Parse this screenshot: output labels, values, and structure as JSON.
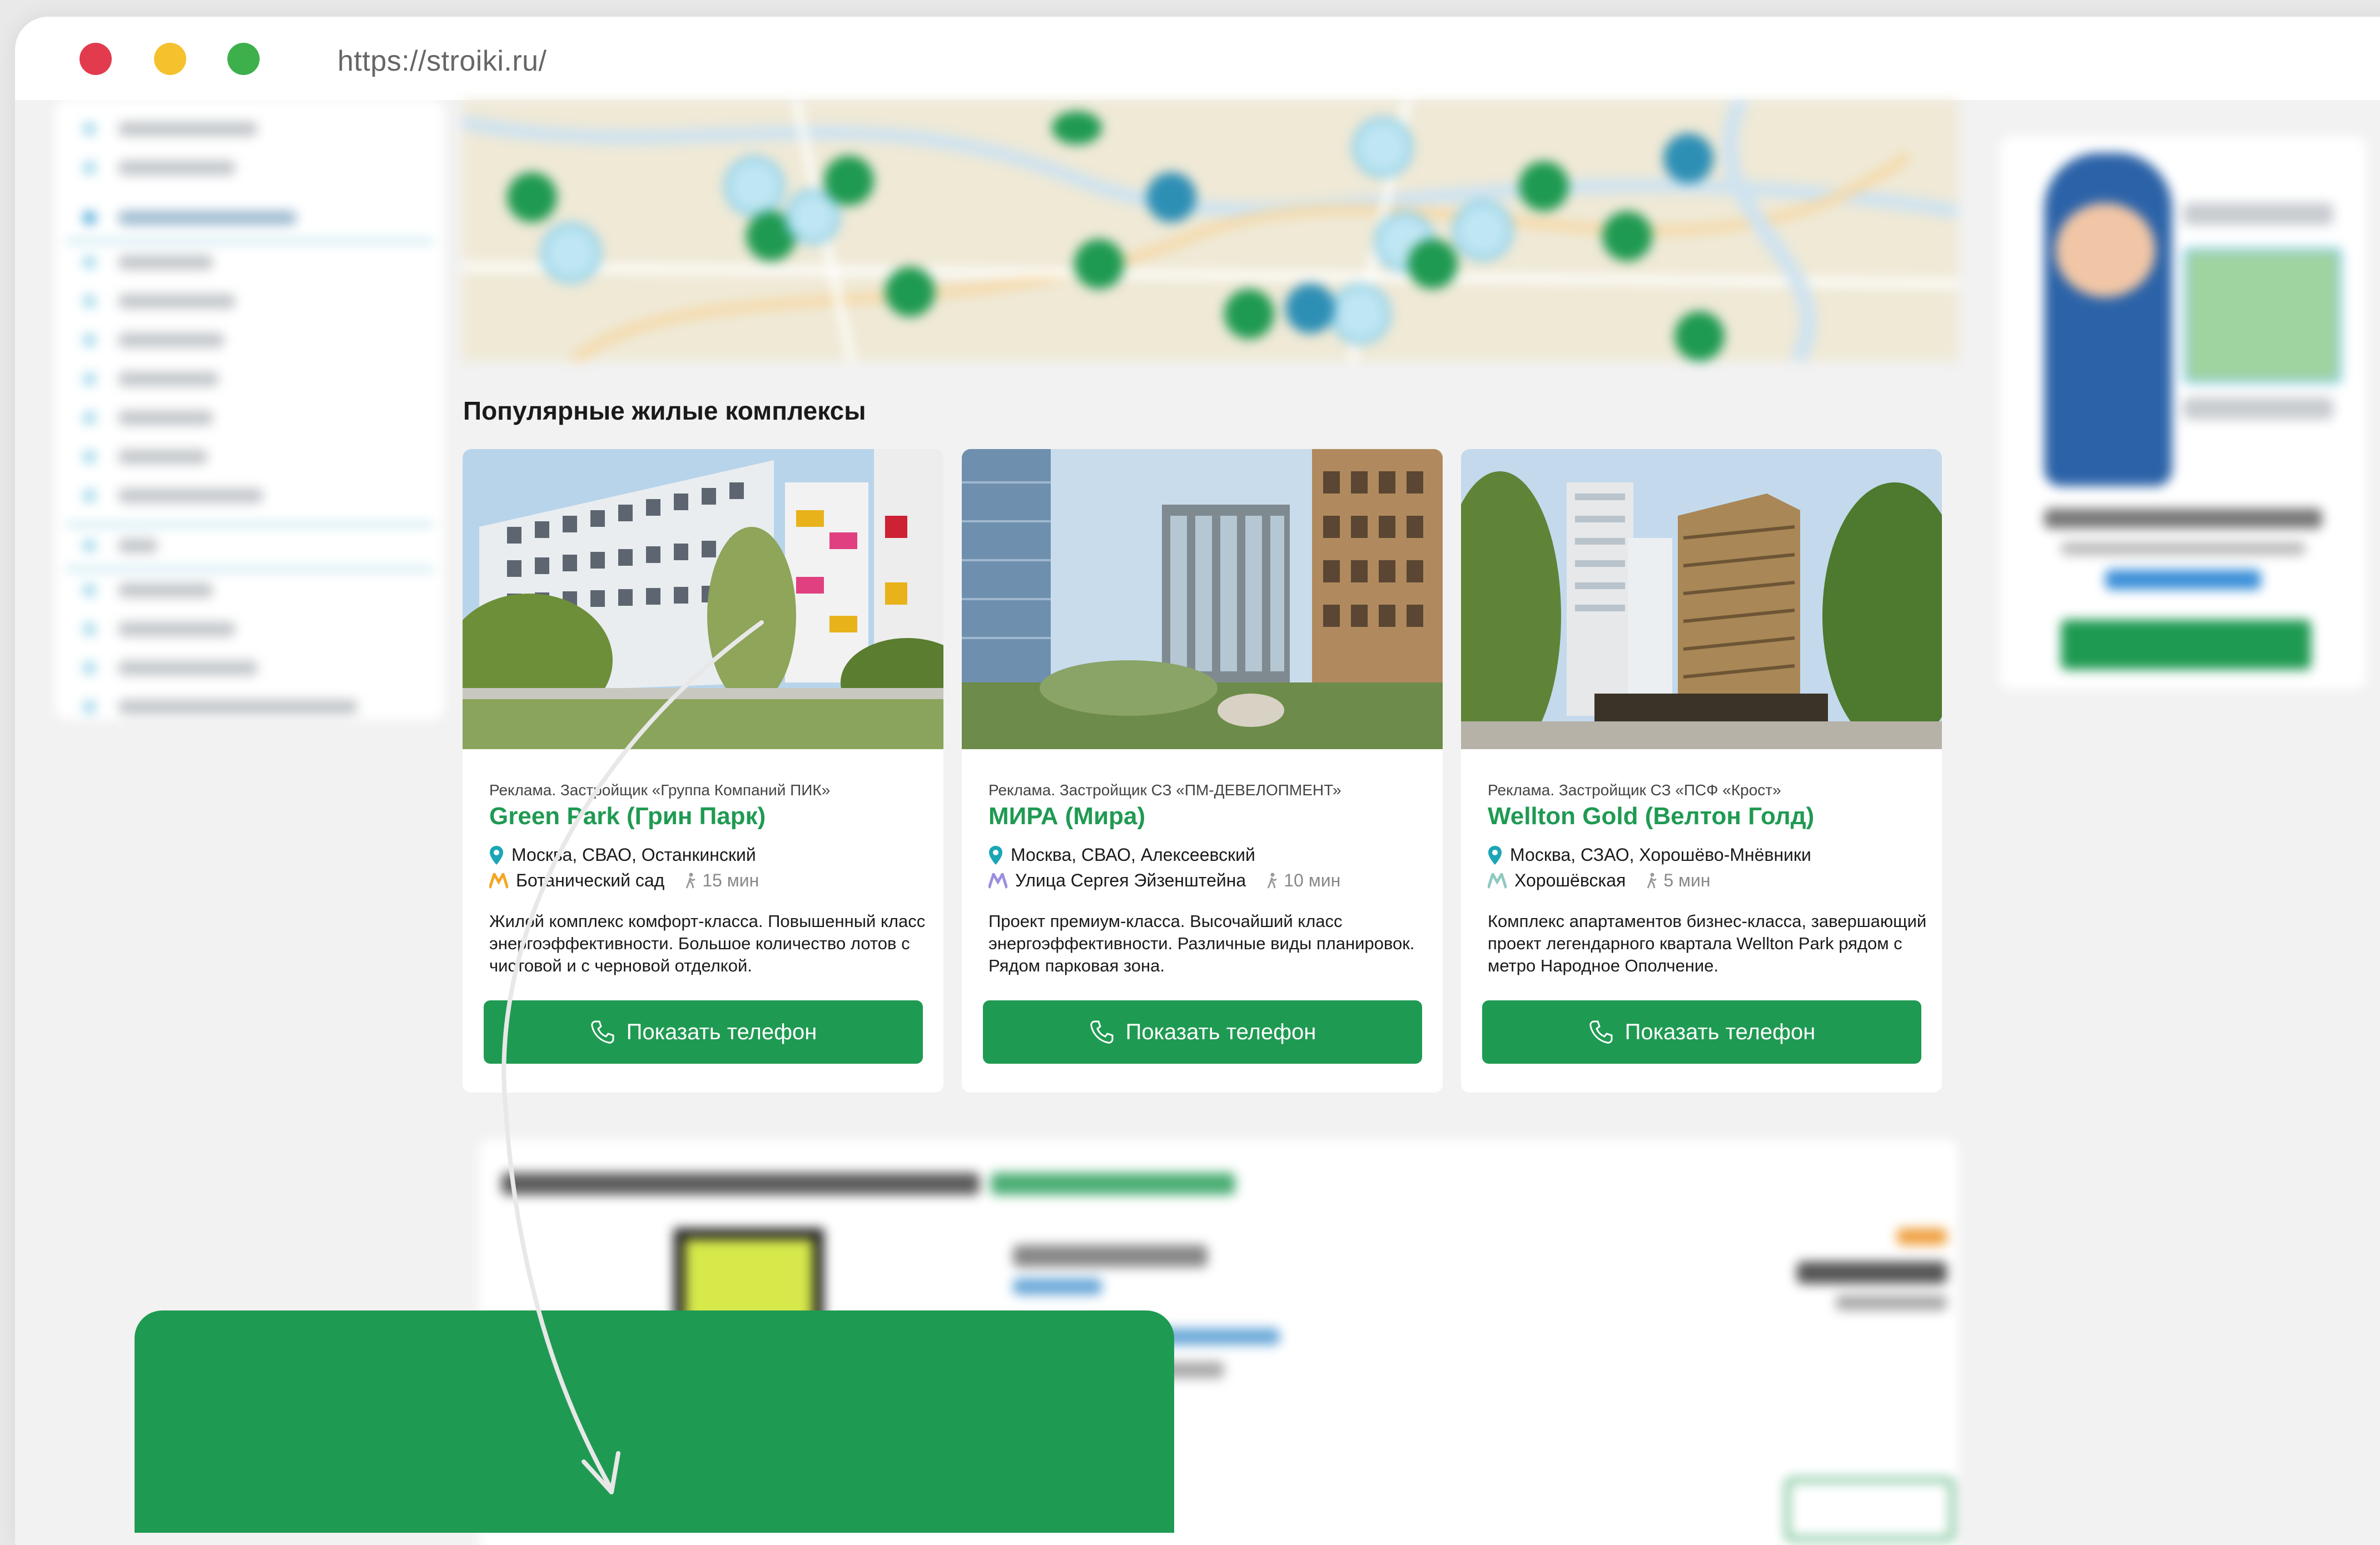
{
  "browser": {
    "url": "https://stroiki.ru/",
    "controls": {
      "close_color": "#e23b4e",
      "minimize_color": "#f5c22e",
      "maximize_color": "#3db04b"
    }
  },
  "section_title": "Популярные жилые комплексы",
  "accent_color": "#1f9a52",
  "cards": [
    {
      "ad": "Реклама. Застройщик «Группа Компаний ПИК»",
      "name": "Green Park (Грин Парк)",
      "location": "Москва, СВАО, Останкинский",
      "metro_icon": "metro-m-icon",
      "metro_color": "#f5a623",
      "metro": "Ботанический сад",
      "walk": "15 мин",
      "description": "Жилой комплекс комфорт-класса. Повышенный класс энергоэффективности. Большое количество лотов с чистовой и с черновой отделкой.",
      "button": "Показать телефон"
    },
    {
      "ad": "Реклама. Застройщик СЗ «ПМ-ДЕВЕЛОПМЕНТ»",
      "name": "МИРА (Мира)",
      "location": "Москва, СВАО, Алексеевский",
      "metro_icon": "metro-m-icon",
      "metro_color": "#9b8fe0",
      "metro": "Улица Сергея Эйзенштейна",
      "walk": "10 мин",
      "description": "Проект премиум-класса. Высочайший класс энергоэффективности. Различные виды планировок. Рядом парковая зона.",
      "button": "Показать телефон"
    },
    {
      "ad": "Реклама. Застройщик СЗ «ПСФ «Крост»",
      "name": "Wellton Gold (Велтон Голд)",
      "location": "Москва, СЗАО, Хорошёво-Мнёвники",
      "metro_icon": "metro-m-icon",
      "metro_color": "#8fc9c0",
      "metro": "Хорошёвская",
      "walk": "5 мин",
      "description": "Комплекс апартаментов бизнес-класса, завершающий проект легендарного квартала Wellton Park рядом с метро Народное Ополчение.",
      "button": "Показать телефон"
    }
  ]
}
